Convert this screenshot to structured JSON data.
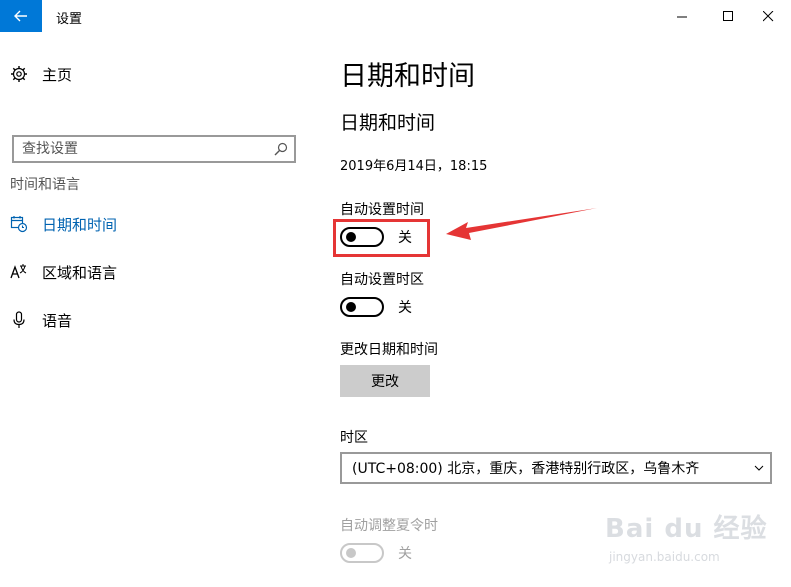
{
  "window": {
    "title": "设置",
    "back_icon": "arrow-left-icon",
    "accent": "#0078d7"
  },
  "sidebar": {
    "home_label": "主页",
    "search_placeholder": "查找设置",
    "section_heading": "时间和语言",
    "items": [
      {
        "label": "日期和时间",
        "icon": "calendar-clock-icon",
        "active": true
      },
      {
        "label": "区域和语言",
        "icon": "language-icon",
        "active": false
      },
      {
        "label": "语音",
        "icon": "microphone-icon",
        "active": false
      }
    ]
  },
  "main": {
    "page_title": "日期和时间",
    "section_title": "日期和时间",
    "current_datetime": "2019年6月14日，18:15",
    "auto_time": {
      "label": "自动设置时间",
      "state": "关"
    },
    "auto_timezone": {
      "label": "自动设置时区",
      "state": "关"
    },
    "change_datetime": {
      "label": "更改日期和时间",
      "button": "更改"
    },
    "timezone": {
      "label": "时区",
      "value": "(UTC+08:00) 北京，重庆，香港特别行政区，乌鲁木齐"
    },
    "dst": {
      "label": "自动调整夏令时",
      "state": "关"
    }
  },
  "annotation": {
    "color": "#e53535"
  },
  "watermark": {
    "brand": "Bai du 经验",
    "site": "jingyan.baidu.com"
  }
}
